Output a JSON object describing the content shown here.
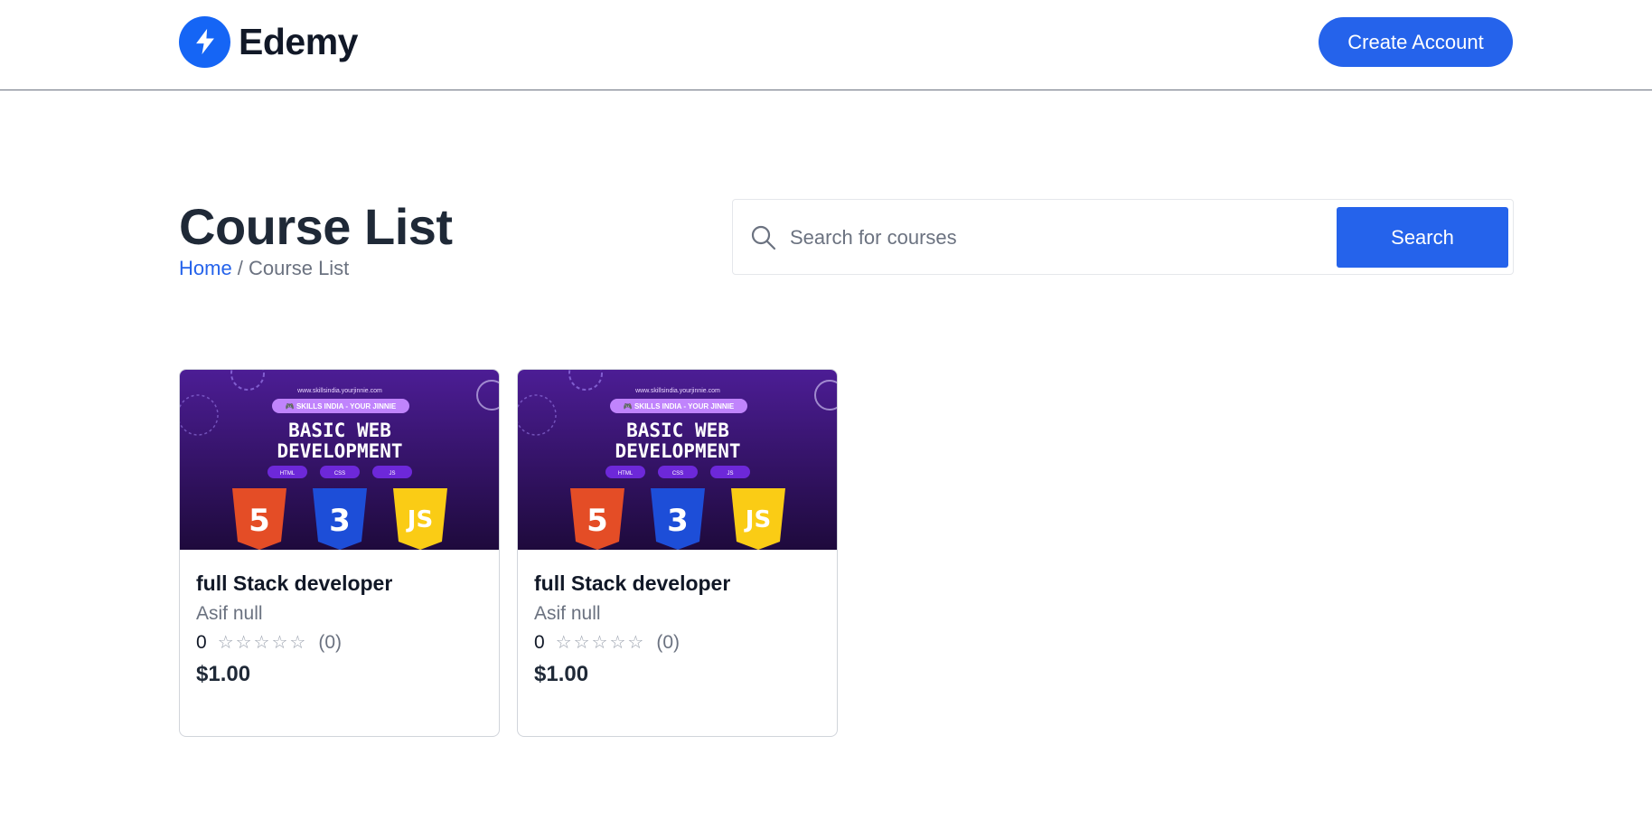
{
  "brand": {
    "name": "Edemy",
    "accent_color": "#2563eb"
  },
  "header": {
    "create_account_label": "Create Account"
  },
  "page": {
    "title": "Course List",
    "breadcrumb": {
      "home": "Home",
      "separator": " / ",
      "current": "Course List"
    }
  },
  "search": {
    "placeholder": "Search for courses",
    "value": "",
    "button_label": "Search",
    "icon": "search-icon"
  },
  "courses": [
    {
      "thumbnail": {
        "url_text": "www.skillsindia.yourjinnie.com",
        "badge": "🎮 SKILLS INDIA - YOUR JINNIE",
        "line1": "BASIC WEB",
        "line2": "DEVELOPMENT",
        "tags": [
          "HTML",
          "CSS",
          "JS"
        ],
        "logos": [
          "5",
          "3",
          "JS"
        ]
      },
      "title": "full Stack developer",
      "educator": "Asif null",
      "rating": "0",
      "stars": "☆☆☆☆☆",
      "rating_count": "(0)",
      "price": "$1.00"
    },
    {
      "thumbnail": {
        "url_text": "www.skillsindia.yourjinnie.com",
        "badge": "🎮 SKILLS INDIA - YOUR JINNIE",
        "line1": "BASIC WEB",
        "line2": "DEVELOPMENT",
        "tags": [
          "HTML",
          "CSS",
          "JS"
        ],
        "logos": [
          "5",
          "3",
          "JS"
        ]
      },
      "title": "full Stack developer",
      "educator": "Asif null",
      "rating": "0",
      "stars": "☆☆☆☆☆",
      "rating_count": "(0)",
      "price": "$1.00"
    }
  ]
}
